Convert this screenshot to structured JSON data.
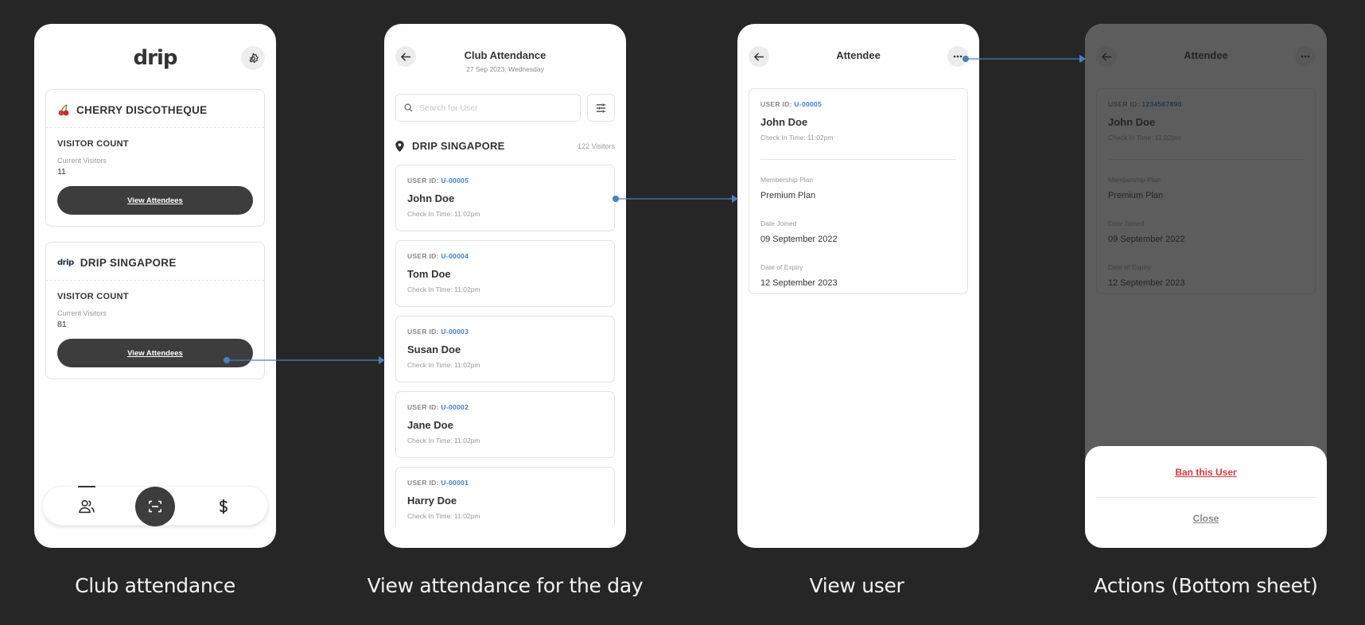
{
  "colors": {
    "background": "#262626",
    "accent_blue": "#3a7bd5",
    "danger": "#d9363e",
    "dark_button": "#3d3d3d",
    "connector": "#4a7fbf"
  },
  "captions": [
    "Club attendance",
    "View attendance for the day",
    "View user",
    "Actions (Bottom sheet)"
  ],
  "screen1": {
    "logo": "drip",
    "settings_icon": "gear-icon",
    "clubs": [
      {
        "name": "CHERRY DISCOTHEQUE",
        "icon": "cherry-icon",
        "section_title": "VISITOR COUNT",
        "visitors_label": "Current Visitors",
        "visitors_value": "11",
        "button_label": "View Attendees"
      },
      {
        "name": "DRIP SINGAPORE",
        "icon": "drip-logo-icon",
        "section_title": "VISITOR COUNT",
        "visitors_label": "Current Visitors",
        "visitors_value": "81",
        "button_label": "View Attendees"
      }
    ],
    "bottom_nav": [
      {
        "icon": "users-icon",
        "active": true
      },
      {
        "icon": "scan-icon",
        "active": false
      },
      {
        "icon": "dollar-icon",
        "active": false
      }
    ]
  },
  "screen2": {
    "title": "Club Attendance",
    "subtitle": "27 Sep 2023, Wednesday",
    "search_placeholder": "Search for User",
    "search_value": "",
    "location_name": "DRIP SINGAPORE",
    "visitor_count": "122 Visitors",
    "users": [
      {
        "id_label": "USER ID:",
        "id": "U-00005",
        "name": "John Doe",
        "checkin": "Check In Time: 11:02pm"
      },
      {
        "id_label": "USER ID:",
        "id": "U-00004",
        "name": "Tom Doe",
        "checkin": "Check In Time: 11:02pm"
      },
      {
        "id_label": "USER ID:",
        "id": "U-00003",
        "name": "Susan Doe",
        "checkin": "Check In Time: 11:02pm"
      },
      {
        "id_label": "USER ID:",
        "id": "U-00002",
        "name": "Jane Doe",
        "checkin": "Check In Time: 11:02pm"
      },
      {
        "id_label": "USER ID:",
        "id": "U-00001",
        "name": "Harry Doe",
        "checkin": "Check In Time: 11:02pm"
      }
    ]
  },
  "screen3": {
    "title": "Attendee",
    "id_label": "USER ID:",
    "id": "U-00005",
    "name": "John Doe",
    "checkin": "Check In Time: 11:02pm",
    "fields": [
      {
        "label": "Membership Plan",
        "value": "Premium Plan"
      },
      {
        "label": "Date Joined",
        "value": "09 September 2022"
      },
      {
        "label": "Date of Expiry",
        "value": "12 September 2023"
      }
    ]
  },
  "screen4": {
    "title": "Attendee",
    "id_label": "USER ID:",
    "id": "1234567890",
    "name": "John Doe",
    "checkin": "Check In Time: 11:02pm",
    "fields": [
      {
        "label": "Membership Plan",
        "value": "Premium Plan"
      },
      {
        "label": "Date Joined",
        "value": "09 September 2022"
      },
      {
        "label": "Date of Expiry",
        "value": "12 September 2023"
      }
    ],
    "sheet": {
      "primary_action": "Ban this User",
      "secondary_action": "Close"
    }
  }
}
